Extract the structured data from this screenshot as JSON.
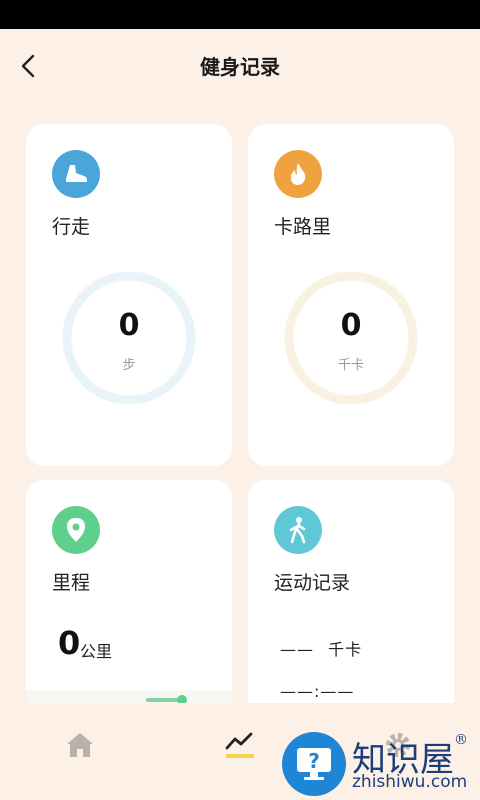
{
  "header": {
    "title": "健身记录"
  },
  "cards": {
    "walk": {
      "label": "行走",
      "value": "0",
      "unit": "步",
      "icon": "shoe-icon",
      "icon_color": "#4aa6d8",
      "ring_color": "#e9f4f9"
    },
    "calorie": {
      "label": "卡路里",
      "value": "0",
      "unit": "千卡",
      "icon": "flame-icon",
      "icon_color": "#f0a23e",
      "ring_color": "#f9f1e1"
    },
    "distance": {
      "label": "里程",
      "value": "0",
      "unit": "公里",
      "icon": "location-pin-icon",
      "icon_color": "#5ecf8c"
    },
    "record": {
      "label": "运动记录",
      "calories_placeholder": "——",
      "calories_unit": "千卡",
      "time_placeholder": "——:——",
      "icon": "walking-person-icon",
      "icon_color": "#5fc8d6"
    }
  },
  "tabbar": {
    "tabs": [
      "home-icon",
      "chart-icon",
      "gear-icon"
    ]
  },
  "watermark": {
    "brand": "知识屋",
    "domain": "zhishiwu.com",
    "mark": "®"
  }
}
